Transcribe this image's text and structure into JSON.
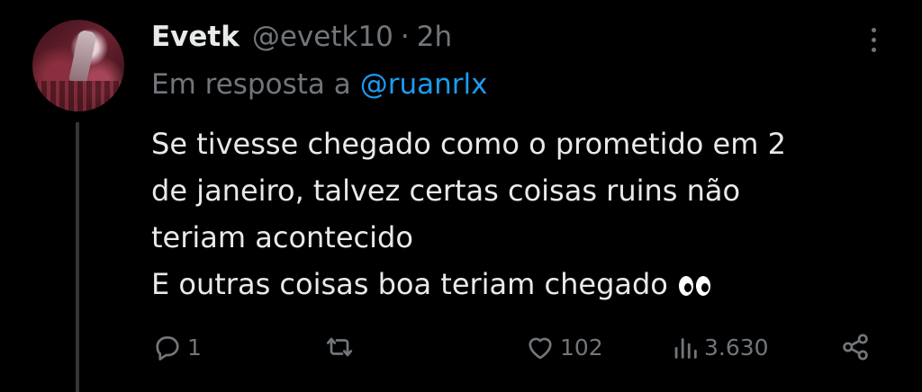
{
  "tweet": {
    "author_name": "Evetk",
    "handle": "@evetk10",
    "separator": "·",
    "time": "2h",
    "reply_prefix": "Em resposta a",
    "reply_mention": "@ruanrlx",
    "lines": [
      "Se tivesse chegado como o prometido em 2",
      "de janeiro, talvez certas coisas ruins não",
      "teriam acontecido",
      "E outras coisas boa teriam chegado"
    ],
    "emoji": "eyes-emoji"
  },
  "actions": {
    "reply_count": "1",
    "retweet_count": "",
    "like_count": "102",
    "view_count": "3.630"
  },
  "icons": {
    "reply": "comment-icon",
    "retweet": "retweet-icon",
    "like": "heart-icon",
    "views": "views-bar-chart-icon",
    "share": "share-icon",
    "more": "more-vertical-icon"
  },
  "colors": {
    "background": "#000000",
    "text": "#e7e9ea",
    "secondary": "#71767b",
    "link": "#1d9bf0",
    "thread_line": "#333639"
  }
}
